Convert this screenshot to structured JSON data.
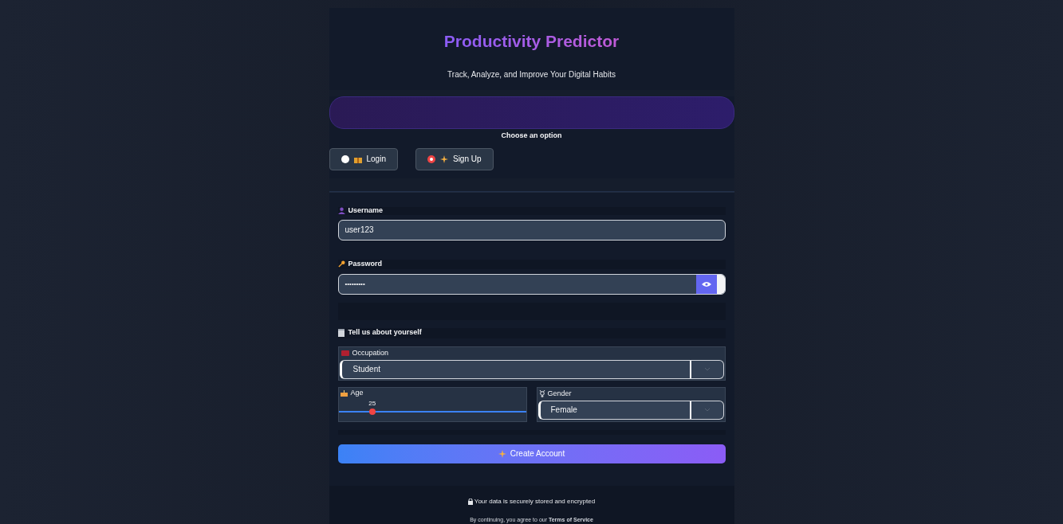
{
  "header": {
    "title": "Productivity Predictor",
    "subtitle": "Track, Analyze, and Improve Your Digital Habits"
  },
  "choice": {
    "label": "Choose an option",
    "options": [
      {
        "label": "Login",
        "selected": false
      },
      {
        "label": "Sign Up",
        "selected": true
      }
    ]
  },
  "form": {
    "username": {
      "label": "Username",
      "value": "user123"
    },
    "password": {
      "label": "Password",
      "value": "•••••••••"
    },
    "section_title": "Tell us about yourself",
    "occupation": {
      "label": "Occupation",
      "value": "Student"
    },
    "age": {
      "label": "Age",
      "value": "25",
      "level": 0.18
    },
    "gender": {
      "label": "Gender",
      "value": "Female"
    },
    "submit": "Create Account"
  },
  "footer": {
    "security_note": "Your data is securely stored and encrypted",
    "terms": "By continuing, you agree to our **Terms of Service**"
  }
}
